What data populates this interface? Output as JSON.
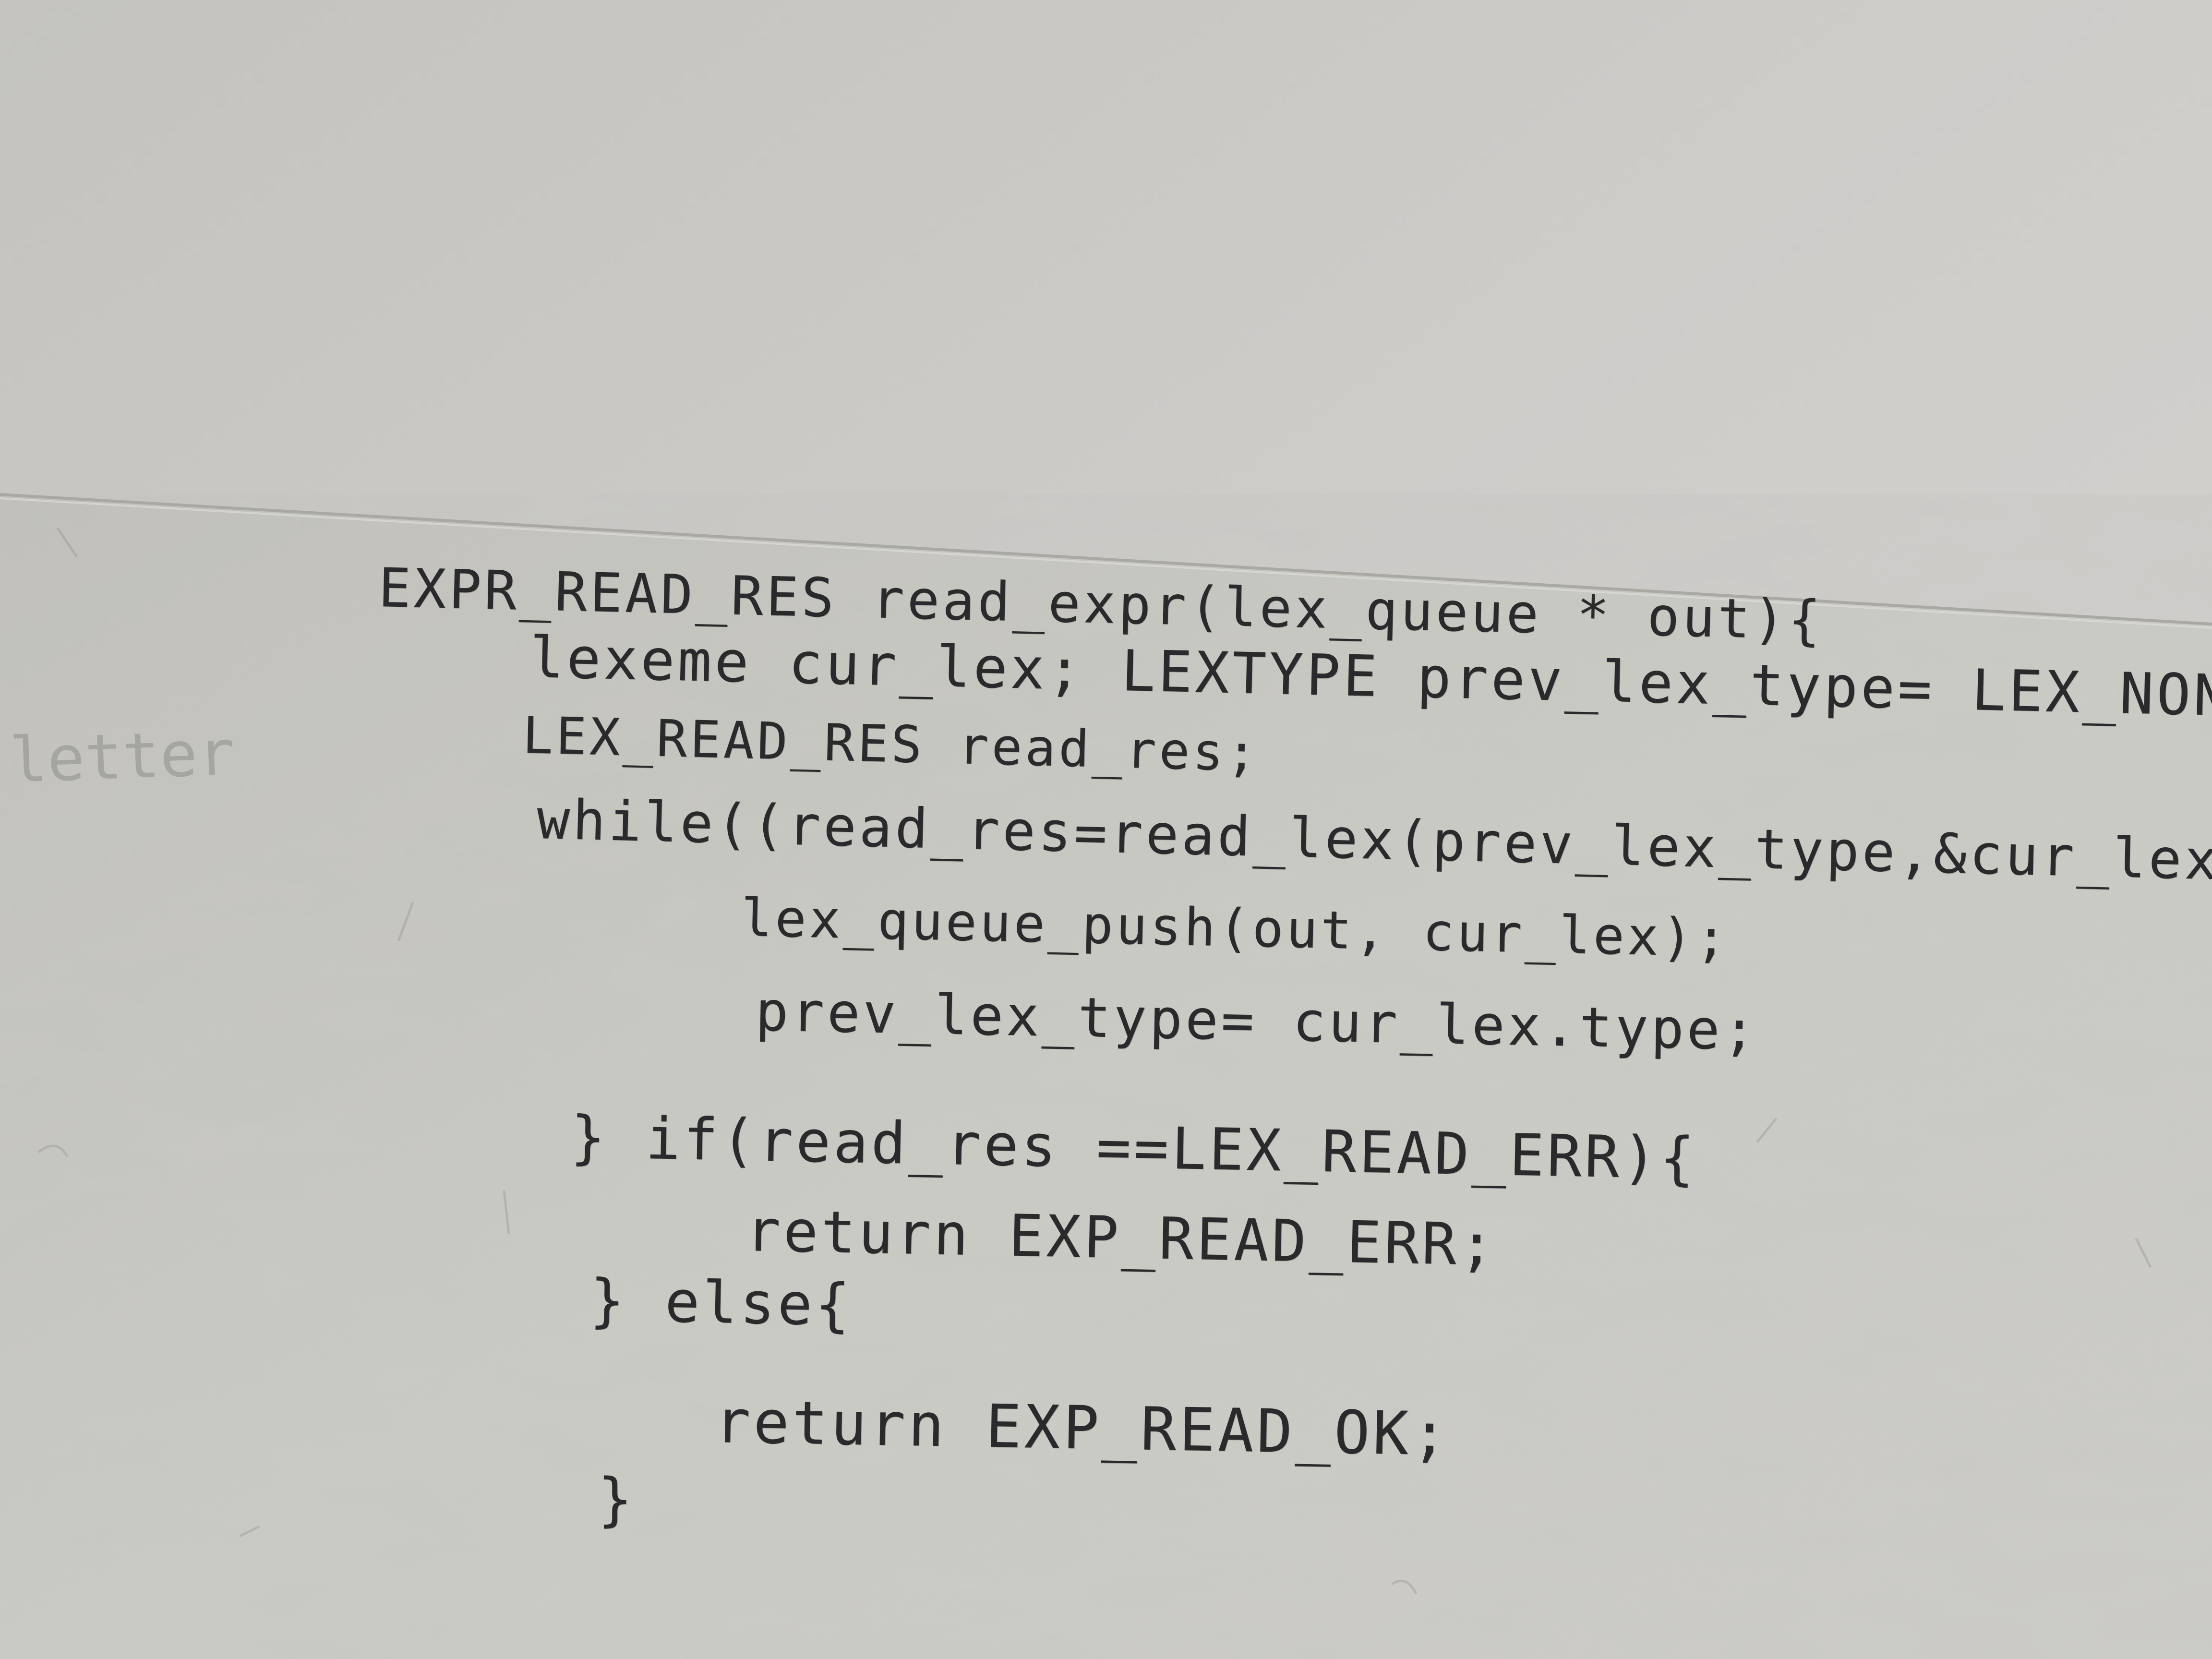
{
  "scene": {
    "description_colors": {
      "wall": "#cbc9c5",
      "board": "#c9c8c2",
      "ink": "#2a2a2c"
    }
  },
  "whiteboard": {
    "faint_text": "letter",
    "code_lines": [
      "EXPR_READ_RES read_expr(lex_queue * out){",
      "lexeme cur_lex; LEXTYPE prev_lex_type= LEX_NONE;",
      "LEX_READ_RES read_res;",
      "while((read_res=read_lex(prev_lex_type,&cur_lex))==LEX_READ_O",
      "lex_queue_push(out, cur_lex);",
      "prev_lex_type= cur_lex.type;",
      "} if(read_res ==LEX_READ_ERR){",
      "return EXP_READ_ERR;",
      "} else{",
      "return EXP_READ_OK;",
      "}"
    ]
  }
}
